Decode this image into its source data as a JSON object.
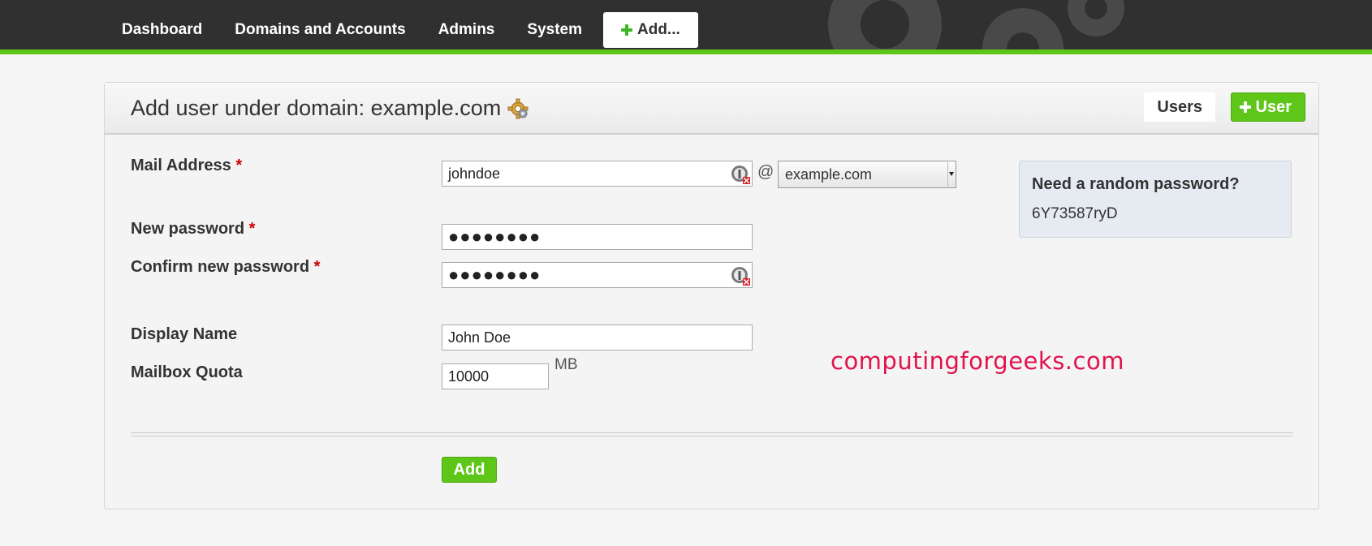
{
  "nav": {
    "items": [
      {
        "label": "Dashboard"
      },
      {
        "label": "Domains and Accounts"
      },
      {
        "label": "Admins"
      },
      {
        "label": "System"
      }
    ],
    "add_label": "Add..."
  },
  "panel": {
    "title": "Add user under domain: example.com",
    "tab_users": "Users",
    "tab_add_user": "User"
  },
  "form": {
    "mail_address_label": "Mail Address",
    "required_mark": "*",
    "mail_local_value": "johndoe",
    "at_sign": "@",
    "domain_selected": "example.com",
    "new_password_label": "New password",
    "new_password_value": "●●●●●●●●",
    "confirm_password_label": "Confirm new password",
    "confirm_password_value": "●●●●●●●●",
    "display_name_label": "Display Name",
    "display_name_value": "John Doe",
    "mailbox_quota_label": "Mailbox Quota",
    "mailbox_quota_value": "10000",
    "quota_unit": "MB",
    "submit_label": "Add"
  },
  "random_password": {
    "title": "Need a random password?",
    "value": "6Y73587ryD"
  },
  "watermark": "computingforgeeks.com",
  "colors": {
    "nav_bg": "#303030",
    "accent_green": "#5ec618",
    "required_red": "#cc0000",
    "watermark": "#e0134f"
  }
}
